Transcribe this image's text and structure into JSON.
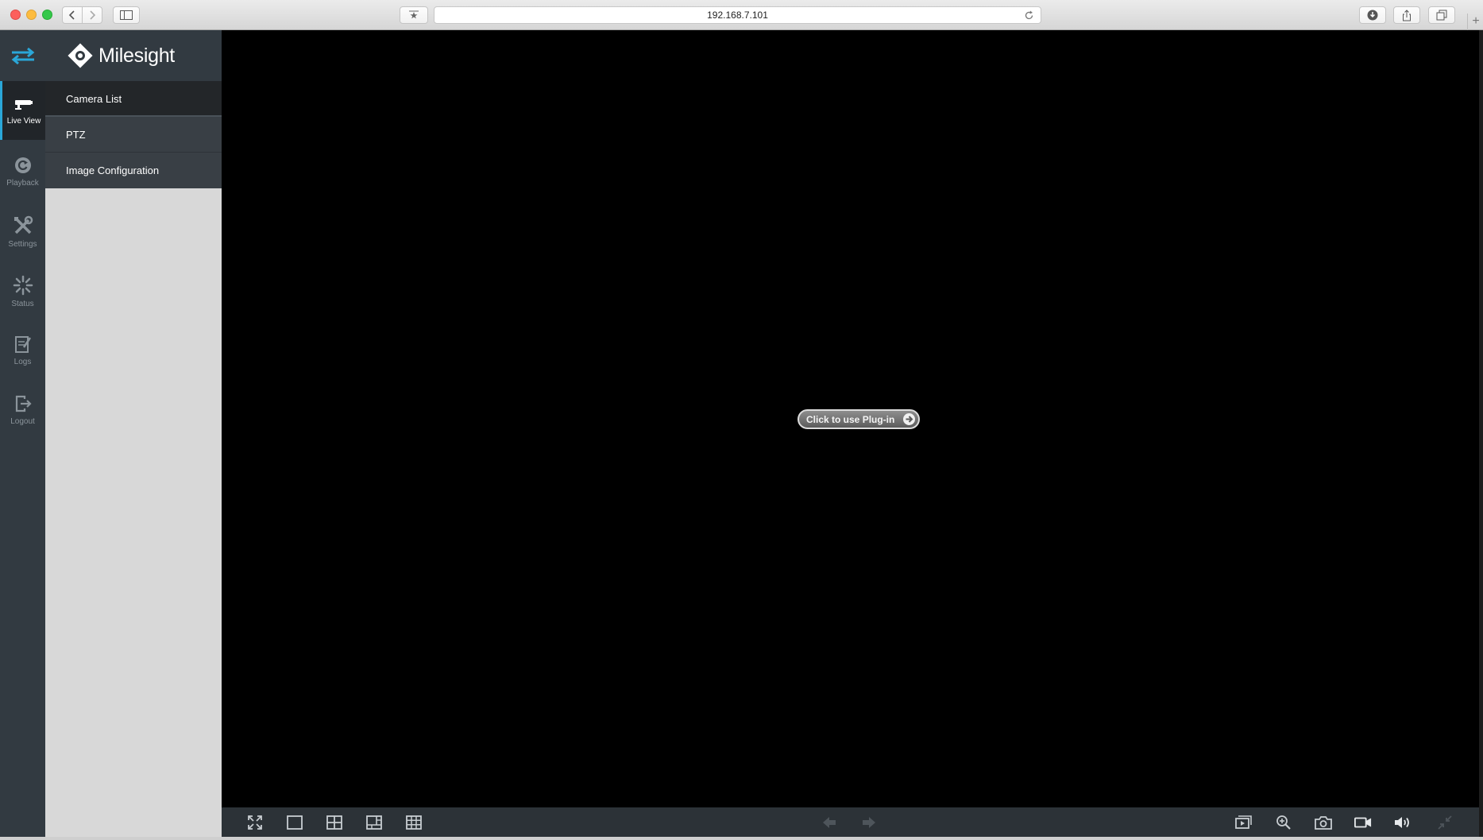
{
  "browser": {
    "url": "192.168.7.101"
  },
  "brand": {
    "name": "Milesight"
  },
  "nav": {
    "items": [
      {
        "label": "Live View",
        "icon": "live-view-icon"
      },
      {
        "label": "Playback",
        "icon": "playback-icon"
      },
      {
        "label": "Settings",
        "icon": "settings-icon"
      },
      {
        "label": "Status",
        "icon": "status-icon"
      },
      {
        "label": "Logs",
        "icon": "logs-icon"
      },
      {
        "label": "Logout",
        "icon": "logout-icon"
      }
    ],
    "active": "Live View"
  },
  "submenu": {
    "items": [
      {
        "label": "Camera List"
      },
      {
        "label": "PTZ"
      },
      {
        "label": "Image Configuration"
      }
    ],
    "active": "Camera List"
  },
  "video": {
    "plugin_button_label": "Click to use Plug-in"
  },
  "colors": {
    "accent": "#2aa7d8",
    "sidebar": "#323a41",
    "panel": "#d8d8d8",
    "video_bg": "#000000"
  }
}
